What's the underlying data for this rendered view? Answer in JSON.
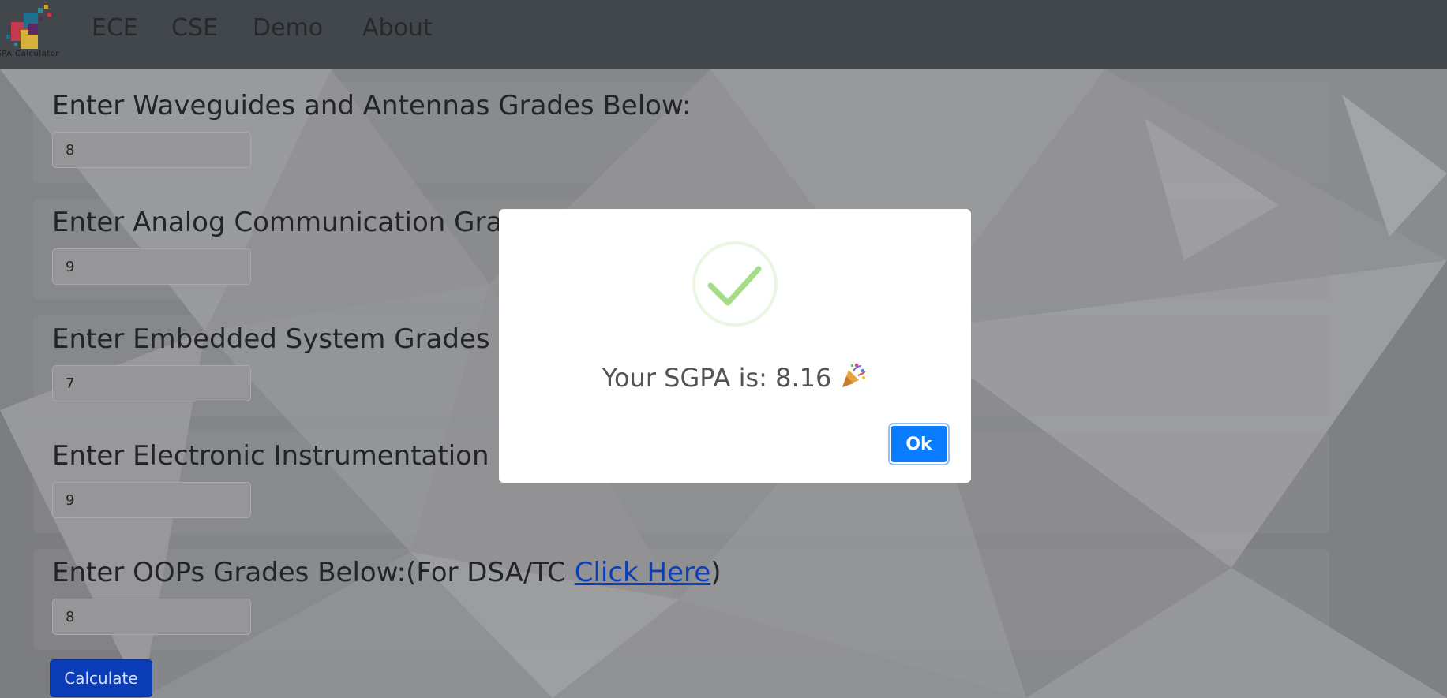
{
  "app": {
    "logo_text": "GPA Calculator"
  },
  "nav": {
    "items": [
      {
        "label": "ECE"
      },
      {
        "label": "CSE"
      },
      {
        "label": "Demo"
      },
      {
        "label": "About"
      }
    ]
  },
  "form": {
    "subjects": [
      {
        "label": "Enter Waveguides and Antennas Grades Below:",
        "value": "8"
      },
      {
        "label": "Enter Analog Communication Grades Below:",
        "value": "9"
      },
      {
        "label": "Enter Embedded System Grades Below:",
        "value": "7"
      },
      {
        "label": "Enter Electronic Instrumentation Grades Below:",
        "value": "9"
      },
      {
        "label_prefix": "Enter OOPs Grades Below:(For DSA/TC ",
        "link_text": "Click Here",
        "label_suffix": ")",
        "value": "8"
      }
    ],
    "calculate_label": "Calculate"
  },
  "modal": {
    "message": "Your SGPA is: 8.16",
    "ok_label": "Ok",
    "icons": [
      "success-check-icon",
      "party-popper-icon"
    ]
  },
  "colors": {
    "navbar": "#42474c",
    "calculate_button": "#0a3cb8",
    "ok_button": "#0a7cff",
    "link": "#0b3fb8",
    "success": "#a5dc86"
  }
}
